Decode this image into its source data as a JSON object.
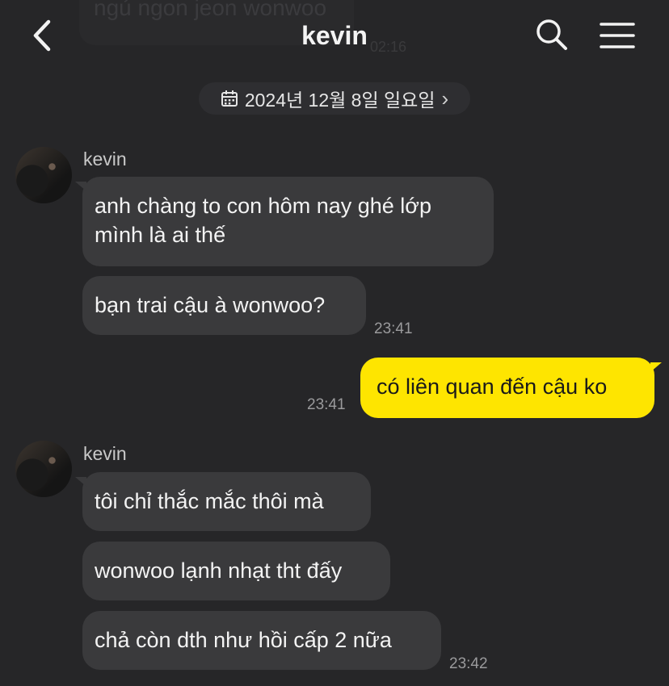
{
  "previous": {
    "message": "ngủ ngon jeon wonwoo",
    "time": "02:16"
  },
  "header": {
    "title": "kevin",
    "back_icon": "chevron-left-icon",
    "search_icon": "search-icon",
    "menu_icon": "menu-icon"
  },
  "date_divider": {
    "label": "2024년 12월 8일 일요일",
    "icon": "calendar-icon",
    "chevron": "›"
  },
  "groups": [
    {
      "sender": "kevin",
      "messages": [
        "anh chàng to con hôm nay ghé lớp mình là ai thế",
        "bạn trai cậu à wonwoo?"
      ],
      "time": "23:41"
    },
    {
      "me": true,
      "messages": [
        "có liên quan đến cậu ko"
      ],
      "time": "23:41"
    },
    {
      "sender": "kevin",
      "messages": [
        "tôi chỉ thắc mắc thôi mà",
        "wonwoo lạnh nhạt tht đấy",
        "chả còn dth như hồi cấp 2 nữa"
      ],
      "time": "23:42"
    }
  ],
  "colors": {
    "background": "#262628",
    "incoming_bubble": "#3a3a3c",
    "outgoing_bubble": "#fee500"
  }
}
